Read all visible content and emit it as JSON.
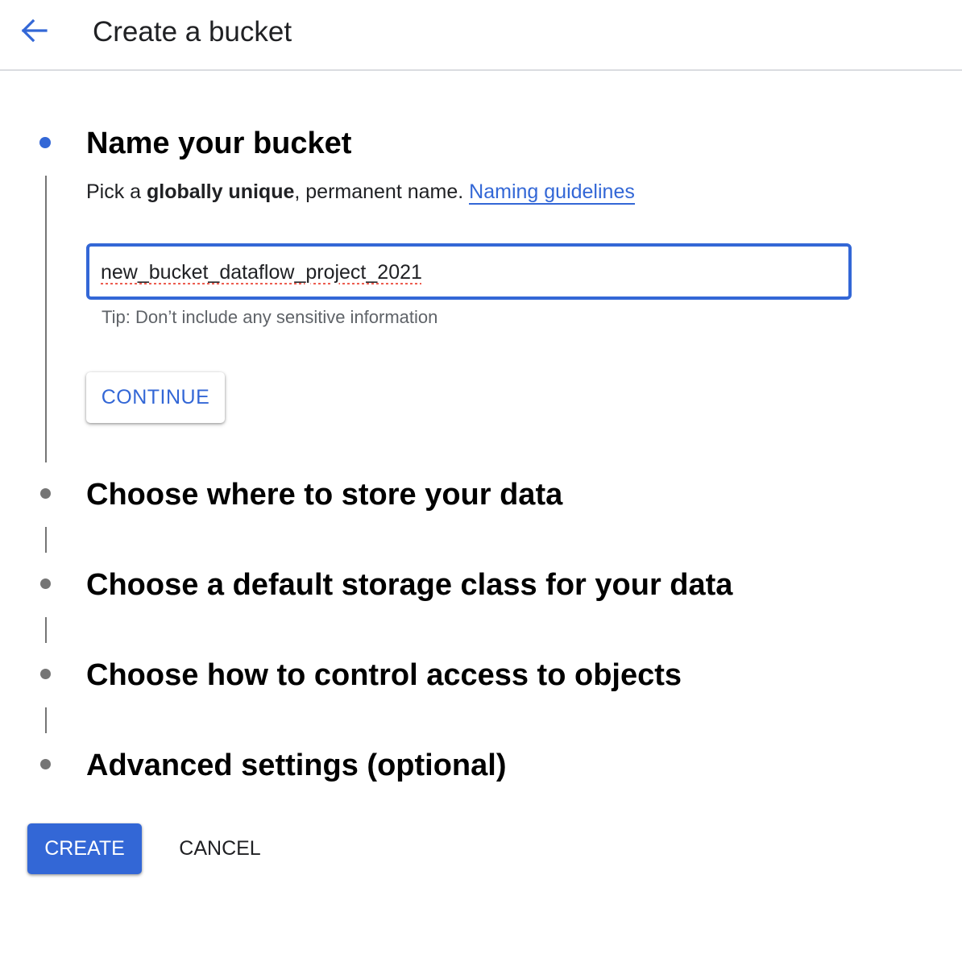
{
  "header": {
    "back_icon": "arrow-back-icon",
    "title": "Create a bucket"
  },
  "steps": [
    {
      "title": "Name your bucket",
      "state": "active",
      "description": {
        "prefix": "Pick a ",
        "bold": "globally unique",
        "suffix": ", permanent name. ",
        "link": "Naming guidelines"
      },
      "input": {
        "value": "new_bucket_dataflow_project_2021"
      },
      "tip": "Tip: Don’t include any sensitive information",
      "continue_label": "CONTINUE"
    },
    {
      "title": "Choose where to store your data",
      "state": "inactive"
    },
    {
      "title": "Choose a default storage class for your data",
      "state": "inactive"
    },
    {
      "title": "Choose how to control access to objects",
      "state": "inactive"
    },
    {
      "title": "Advanced settings (optional)",
      "state": "inactive"
    }
  ],
  "actions": {
    "create_label": "CREATE",
    "cancel_label": "CANCEL"
  },
  "colors": {
    "accent": "#3367d6",
    "inactive_dot": "#757575",
    "divider": "#dadce0"
  }
}
